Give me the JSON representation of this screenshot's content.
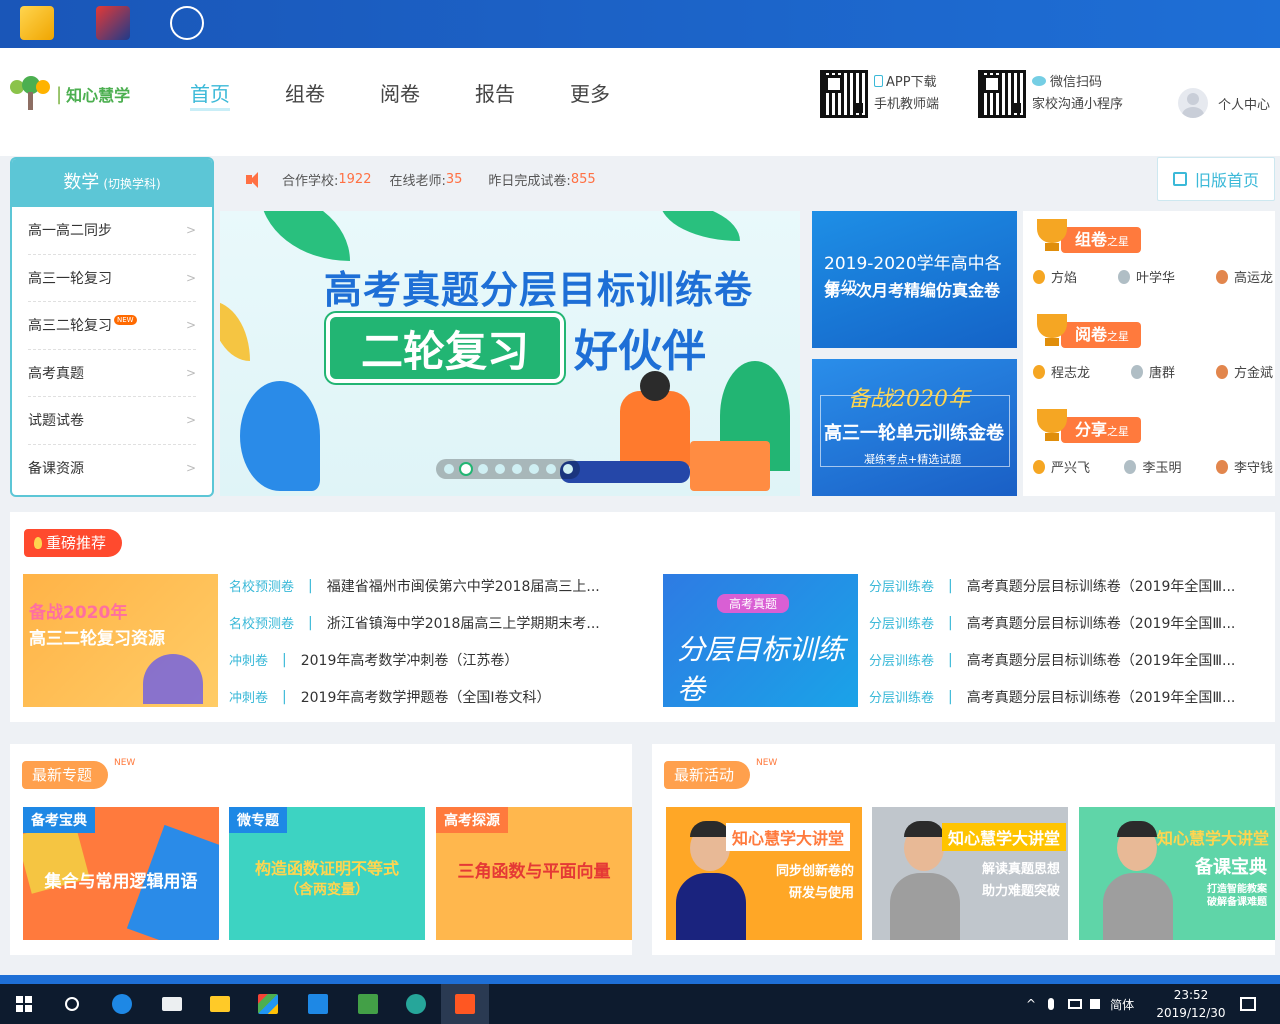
{
  "header": {
    "logo_text": "知心慧学",
    "nav": [
      "首页",
      "组卷",
      "阅卷",
      "报告",
      "更多"
    ],
    "app_download": "APP下载",
    "teacher_app": "手机教师端",
    "wechat_scan": "微信扫码",
    "mini_program": "家校沟通小程序",
    "user_center": "个人中心"
  },
  "subject_panel": {
    "subject": "数学",
    "switch_label": "(切换学科)",
    "items": [
      "高一高二同步",
      "高三一轮复习",
      "高三二轮复习",
      "高考真题",
      "试题试卷",
      "备课资源"
    ],
    "new_tag": "NEW"
  },
  "stats": {
    "schools_label": "合作学校:",
    "schools": "1922",
    "teachers_label": "在线老师:",
    "teachers": "35",
    "papers_label": "昨日完成试卷:",
    "papers": "855"
  },
  "old_home": "旧版首页",
  "banner": {
    "title": "高考真题分层目标训练卷",
    "box_text": "二轮复习",
    "partner_text": "好伙伴",
    "dot_count": 8,
    "active_dot": 1
  },
  "promos": [
    {
      "line1": "2019-2020学年高中各年级",
      "line2": "第一次月考精编仿真金卷"
    },
    {
      "line1": "备战2020年",
      "line2": "高三一轮单元训练金卷",
      "line3": "凝练考点+精选试题"
    }
  ],
  "stars": [
    {
      "title": "组卷",
      "suffix": "之星",
      "names": [
        "方焰",
        "叶学华",
        "高运龙"
      ]
    },
    {
      "title": "阅卷",
      "suffix": "之星",
      "names": [
        "程志龙",
        "唐群",
        "方金斌"
      ]
    },
    {
      "title": "分享",
      "suffix": "之星",
      "names": [
        "严兴飞",
        "李玉明",
        "李守钱"
      ]
    }
  ],
  "recommend": {
    "title": "重磅推荐",
    "image1": {
      "line1": "备战2020年",
      "line2": "高三二轮复习资源"
    },
    "left_list": [
      {
        "cat": "名校预测卷",
        "title": "福建省福州市闽侯第六中学2018届高三上..."
      },
      {
        "cat": "名校预测卷",
        "title": "浙江省镇海中学2018届高三上学期期末考..."
      },
      {
        "cat": "冲刺卷",
        "title": "2019年高考数学冲刺卷（江苏卷）"
      },
      {
        "cat": "冲刺卷",
        "title": "2019年高考数学押题卷（全国Ⅰ卷文科）"
      }
    ],
    "image2": {
      "tag": "高考真题",
      "text": "分层目标训练卷"
    },
    "right_list": [
      {
        "cat": "分层训练卷",
        "title": "高考真题分层目标训练卷（2019年全国Ⅲ..."
      },
      {
        "cat": "分层训练卷",
        "title": "高考真题分层目标训练卷（2019年全国Ⅲ..."
      },
      {
        "cat": "分层训练卷",
        "title": "高考真题分层目标训练卷（2019年全国Ⅲ..."
      },
      {
        "cat": "分层训练卷",
        "title": "高考真题分层目标训练卷（2019年全国Ⅲ..."
      }
    ]
  },
  "topics": {
    "title": "最新专题",
    "new": "NEW",
    "cards": [
      {
        "corner": "备考宝典",
        "main": "集合与常用逻辑用语",
        "color": "#ff7a3d"
      },
      {
        "corner": "微专题",
        "main1": "构造函数证明不等式",
        "main2": "（含两变量）",
        "color": "#3dd3c2"
      },
      {
        "corner": "高考探源",
        "main": "三角函数与平面向量",
        "color": "#ffb74d"
      }
    ]
  },
  "activities": {
    "title": "最新活动",
    "new": "NEW",
    "cards": [
      {
        "band": "知心慧学大讲堂",
        "sub1": "同步创新卷的",
        "sub2": "研发与使用"
      },
      {
        "band": "知心慧学大讲堂",
        "sub1": "解读真题思想",
        "sub2": "助力难题突破"
      },
      {
        "band": "知心慧学大讲堂",
        "sub1": "备课宝典",
        "sub2": "打造智能教案",
        "sub3": "破解备课难题"
      }
    ]
  },
  "taskbar": {
    "lang": "简体",
    "time": "23:52",
    "date": "2019/12/30"
  }
}
